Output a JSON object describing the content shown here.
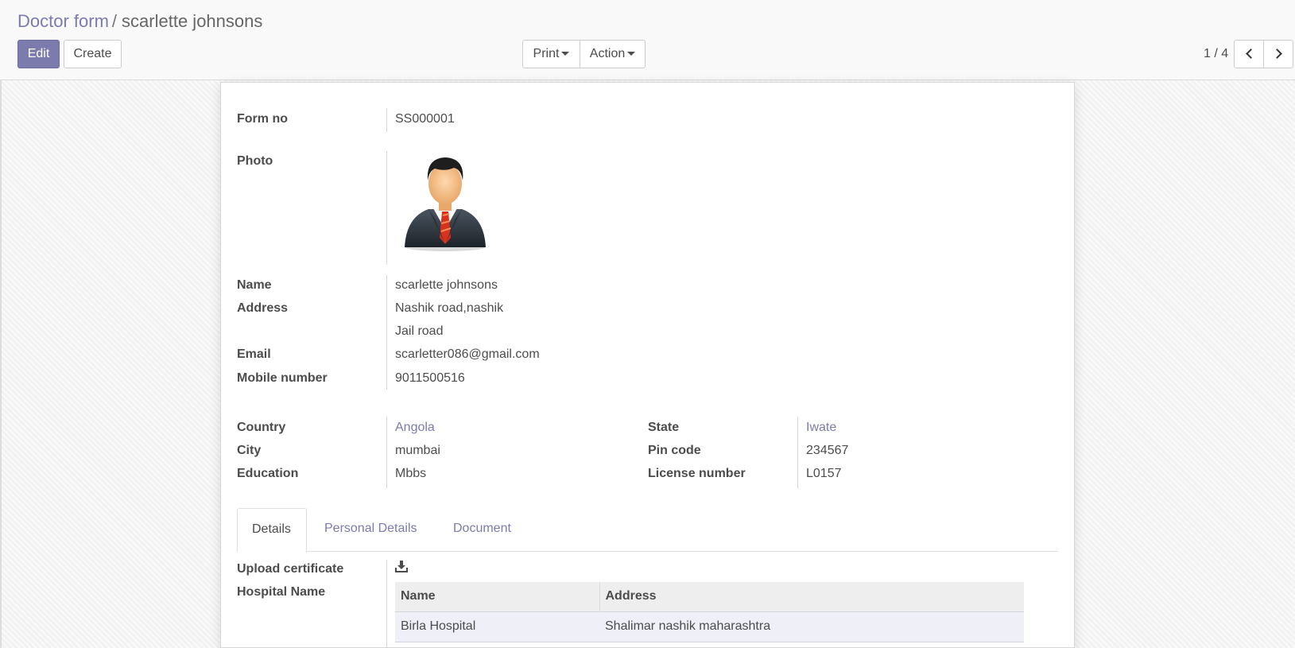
{
  "breadcrumb": {
    "parent": "Doctor form",
    "separator": "/",
    "current": "scarlette johnsons"
  },
  "toolbar": {
    "edit_label": "Edit",
    "create_label": "Create",
    "print_label": "Print",
    "action_label": "Action"
  },
  "pager": {
    "value": "1 / 4"
  },
  "form": {
    "form_no_label": "Form no",
    "form_no": "SS000001",
    "photo_label": "Photo",
    "name_label": "Name",
    "name": "scarlette johnsons",
    "address_label": "Address",
    "address_line1": "Nashik road,nashik",
    "address_line2": "Jail road",
    "email_label": "Email",
    "email": "scarletter086@gmail.com",
    "mobile_label": "Mobile number",
    "mobile": "9011500516",
    "country_label": "Country",
    "country": "Angola",
    "city_label": "City",
    "city": "mumbai",
    "education_label": "Education",
    "education": "Mbbs",
    "state_label": "State",
    "state": "Iwate",
    "pin_label": "Pin code",
    "pin": "234567",
    "license_label": "License number",
    "license": "L0157"
  },
  "tabs": [
    "Details",
    "Personal Details",
    "Document"
  ],
  "details": {
    "upload_label": "Upload certificate",
    "hospital_label": "Hospital Name",
    "table": {
      "columns": [
        "Name",
        "Address"
      ],
      "rows": [
        [
          "Birla Hospital",
          "Shalimar nashik maharashtra"
        ]
      ]
    }
  },
  "colors": {
    "accent": "#7c7bad"
  }
}
